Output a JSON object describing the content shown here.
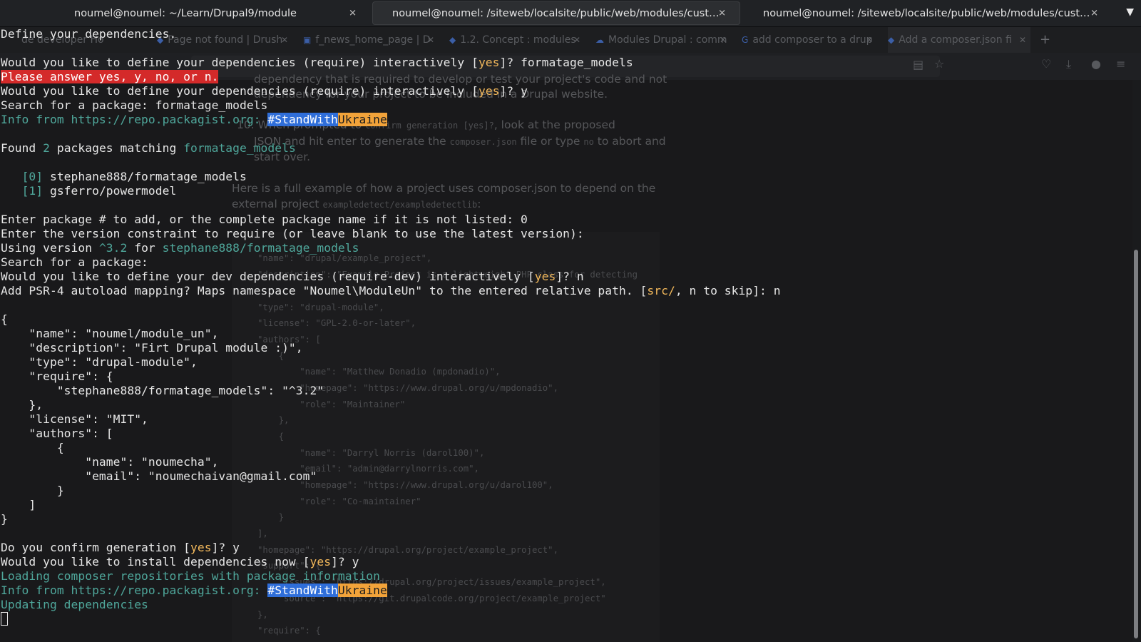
{
  "terminal_tabs": [
    {
      "title": "noumel@noumel: ~/Learn/Drupal9/module",
      "close": "✕"
    },
    {
      "title": "noumel@noumel: /siteweb/localsite/public/web/modules/custom/m…",
      "close": "✕"
    },
    {
      "title": "noumel@noumel: /siteweb/localsite/public/web/modules/custom/fo…",
      "close": "✕"
    }
  ],
  "tabbar_menu_icon": "chevron-down-icon",
  "browser_tabs": [
    {
      "title": "de developer Ho",
      "close": "✕"
    },
    {
      "title": "Page not found | Drush",
      "close": "✕"
    },
    {
      "title": "f_news_home_page | D",
      "close": "✕"
    },
    {
      "title": "1.2. Concept : modules",
      "close": "✕"
    },
    {
      "title": "Modules Drupal : comm",
      "close": "✕"
    },
    {
      "title": "add composer to a drup",
      "close": "✕"
    },
    {
      "title": "Add a composer.json fi",
      "close": "✕"
    }
  ],
  "browser_new_tab": "+",
  "browser_prose": {
    "p1": "dependency that is required to develop or test your project's code and not",
    "p2": "dependency for your project to be included in a Drupal website.",
    "p3_num": "10. When prompted to",
    "p3_code": "confirm generation [yes]?",
    "p3_rest": ", look at the proposed",
    "p4_a": "JSON and hit enter to generate the",
    "p4_code": "composer.json",
    "p4_b": "file or type",
    "p4_code2": "no",
    "p4_c": "to abort and",
    "p5": "start over.",
    "p6": "Here is a full example of how a project uses composer.json to depend on the",
    "p7_a": "external project",
    "p7_code": "exampledetect/exampledetectlib",
    "p7_b": ":"
  },
  "browser_code_lines": [
    "\"name\": \"drupal/example_project\",",
    "\"description\": \"Example Project is a lightweight PHP class for detecting",
    "\"type\": \"drupal-module\",",
    "\"license\": \"GPL-2.0-or-later\",",
    "\"authors\": [",
    "    {",
    "        \"name\": \"Matthew Donadio (mpdonadio)\",",
    "        \"homepage\": \"https://www.drupal.org/u/mpdonadio\",",
    "        \"role\": \"Maintainer\"",
    "    },",
    "    {",
    "        \"name\": \"Darryl Norris (darol100)\",",
    "        \"email\": \"admin@darrylnorris.com\",",
    "        \"homepage\": \"https://www.drupal.org/u/darol100\",",
    "        \"role\": \"Co-maintainer\"",
    "    }",
    "],",
    "\"homepage\": \"https://drupal.org/project/example_project\",",
    "\"support\": {",
    "    \"issues\": \"https://drupal.org/project/issues/example_project\",",
    "    \"source\": \"https://git.drupalcode.org/project/example_project\"",
    "},",
    "\"require\": {"
  ],
  "terminal": {
    "l01": "Define your dependencies.",
    "l03a": "Would you like to define your dependencies (require) interactively [",
    "l03y": "yes",
    "l03b": "]? formatage_models",
    "l04": "Please answer yes, y, no, or n.",
    "l05a": "Would you like to define your dependencies (require) interactively [",
    "l05y": "yes",
    "l05b": "]? y",
    "l06": "Search for a package: formatage_models",
    "l07a": "Info from https://repo.packagist.org: ",
    "l07s": "#StandWith",
    "l07u": "Ukraine",
    "l09a": "Found ",
    "l09n": "2",
    "l09b": " packages matching ",
    "l09q": "formatage_models",
    "l11i": "[0]",
    "l11p": " stephane888/formatage_models",
    "l12i": "[1]",
    "l12p": " gsferro/powermodel",
    "l14": "Enter package # to add, or the complete package name if it is not listed: 0",
    "l15": "Enter the version constraint to require (or leave blank to use the latest version):",
    "l16a": "Using version ",
    "l16v": "^3.2",
    "l16b": " for ",
    "l16p": "stephane888/formatage_models",
    "l17": "Search for a package:",
    "l18a": "Would you like to define your dev dependencies (require-dev) interactively [",
    "l18y": "yes",
    "l18b": "]? n",
    "l19a": "Add PSR-4 autoload mapping? Maps namespace \"Noumel\\ModuleUn\" to the entered relative path. [",
    "l19s": "src/",
    "l19b": ", n to skip]: n",
    "json": [
      "{",
      "    \"name\": \"noumel/module_un\",",
      "    \"description\": \"Firt Drupal module :)\",",
      "    \"type\": \"drupal-module\",",
      "    \"require\": {",
      "        \"stephane888/formatage_models\": \"^3.2\"",
      "    },",
      "    \"license\": \"MIT\",",
      "    \"authors\": [",
      "        {",
      "            \"name\": \"noumecha\",",
      "            \"email\": \"noumechaivan@gmail.com\"",
      "        }",
      "    ]",
      "}"
    ],
    "l37a": "Do you confirm generation [",
    "l37y": "yes",
    "l37b": "]? y",
    "l38a": "Would you like to install dependencies now [",
    "l38y": "yes",
    "l38b": "]? y",
    "l39": "Loading composer repositories with package information",
    "l40a": "Info from https://repo.packagist.org: ",
    "l40s": "#StandWith",
    "l40u": "Ukraine",
    "l41": "Updating dependencies"
  },
  "colors": {
    "yes": "#f2b85b",
    "cyan": "#4fa79b",
    "error_bg": "#d42a2a",
    "stand_bg": "#2f6ed9",
    "ukraine_bg": "#f2a33a"
  }
}
